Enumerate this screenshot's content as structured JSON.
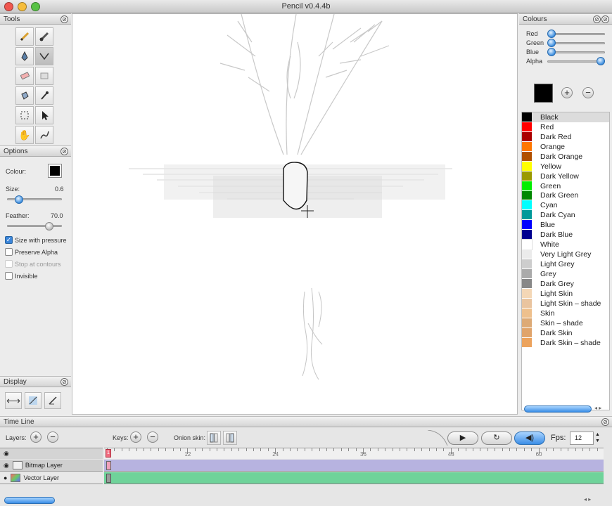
{
  "app": {
    "title": "Pencil v0.4.4b"
  },
  "tools_panel": {
    "title": "Tools"
  },
  "options_panel": {
    "title": "Options",
    "colour_label": "Colour:",
    "size_label": "Size:",
    "size_value": "0.6",
    "feather_label": "Feather:",
    "feather_value": "70.0",
    "checkboxes": [
      {
        "label": "Size with pressure",
        "checked": true
      },
      {
        "label": "Preserve Alpha",
        "checked": false
      },
      {
        "label": "Stop at contours",
        "checked": false
      },
      {
        "label": "Invisible",
        "checked": false
      }
    ]
  },
  "display_panel": {
    "title": "Display"
  },
  "colours_panel": {
    "title": "Colours",
    "sliders": [
      {
        "label": "Red",
        "value": 0
      },
      {
        "label": "Green",
        "value": 0
      },
      {
        "label": "Blue",
        "value": 0
      },
      {
        "label": "Alpha",
        "value": 1
      }
    ],
    "current_colour": "#000000",
    "add": "+",
    "remove": "−",
    "list": [
      {
        "name": "Black",
        "color": "#000000"
      },
      {
        "name": "Red",
        "color": "#ff0000"
      },
      {
        "name": "Dark Red",
        "color": "#aa0000"
      },
      {
        "name": "Orange",
        "color": "#ff7700"
      },
      {
        "name": "Dark Orange",
        "color": "#b05000"
      },
      {
        "name": "Yellow",
        "color": "#ffff00"
      },
      {
        "name": "Dark Yellow",
        "color": "#999900"
      },
      {
        "name": "Green",
        "color": "#00ee00"
      },
      {
        "name": "Dark Green",
        "color": "#008800"
      },
      {
        "name": "Cyan",
        "color": "#00ffff"
      },
      {
        "name": "Dark Cyan",
        "color": "#009999"
      },
      {
        "name": "Blue",
        "color": "#0000ff"
      },
      {
        "name": "Dark Blue",
        "color": "#00008f"
      },
      {
        "name": "White",
        "color": "#ffffff"
      },
      {
        "name": "Very Light Grey",
        "color": "#ebebeb"
      },
      {
        "name": "Light Grey",
        "color": "#cdcdcd"
      },
      {
        "name": "Grey",
        "color": "#aaaaaa"
      },
      {
        "name": "Dark Grey",
        "color": "#888888"
      },
      {
        "name": "Light Skin",
        "color": "#f4d7b6"
      },
      {
        "name": "Light Skin – shade",
        "color": "#e9c49f"
      },
      {
        "name": "Skin",
        "color": "#eec08d"
      },
      {
        "name": "Skin – shade",
        "color": "#ddaa76"
      },
      {
        "name": "Dark Skin",
        "color": "#e0a46b"
      },
      {
        "name": "Dark Skin – shade",
        "color": "#eca35d"
      }
    ]
  },
  "timeline": {
    "title": "Time Line",
    "layers_label": "Layers:",
    "keys_label": "Keys:",
    "onion_label": "Onion skin:",
    "fps_label": "Fps:",
    "fps_value": "12",
    "current_frame": "1",
    "ticks": [
      "12",
      "24",
      "36",
      "48",
      "60"
    ],
    "layers": [
      {
        "name": "Bitmap Layer",
        "color": "#b7b3e0"
      },
      {
        "name": "Vector Layer",
        "color": "#6fd39a"
      }
    ]
  }
}
